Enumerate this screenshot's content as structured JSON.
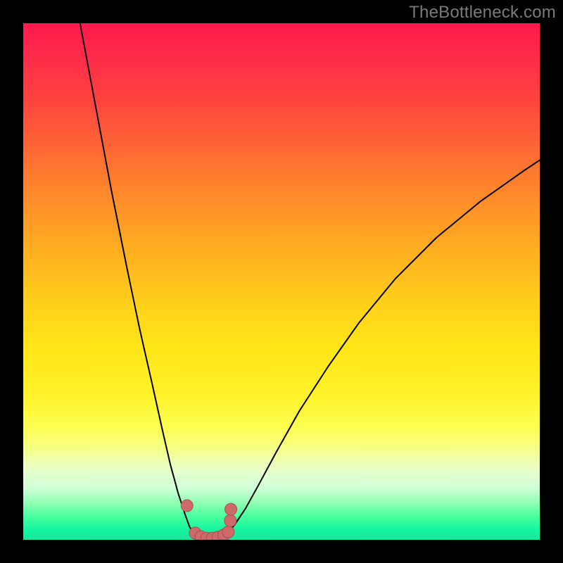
{
  "watermark": "TheBottleneck.com",
  "colors": {
    "background": "#000000",
    "watermark": "#7a7a7a",
    "curve": "#000000",
    "marker_fill": "#cf6a6a",
    "marker_stroke": "#a84f4f",
    "gradient_stops": [
      "#ff1a4d",
      "#ff2a4a",
      "#ff4040",
      "#ff6a33",
      "#ff8c2a",
      "#ffb21f",
      "#ffd21a",
      "#ffe617",
      "#fff22a",
      "#fdff4f",
      "#f7ff80",
      "#eaffc4",
      "#d0ffd9",
      "#8cffb0",
      "#3cff9e",
      "#17f5a0",
      "#13eaa0"
    ]
  },
  "chart_data": {
    "type": "line",
    "title": "",
    "xlabel": "",
    "ylabel": "",
    "xlim": [
      0,
      100
    ],
    "ylim": [
      0,
      100
    ],
    "grid": false,
    "legend": false,
    "note": "Axes have no visible tick labels; x/y are normalized percentages of the plot area (0 = left/bottom, 100 = right/top). Values estimated from pixel positions.",
    "series": [
      {
        "name": "left-branch",
        "x": [
          11.0,
          14.0,
          17.0,
          20.0,
          22.5,
          25.0,
          27.0,
          28.5,
          30.0,
          31.3,
          32.2,
          33.0
        ],
        "y": [
          100.0,
          84.0,
          68.0,
          53.0,
          41.0,
          30.0,
          21.0,
          14.5,
          9.0,
          5.0,
          2.5,
          1.2
        ]
      },
      {
        "name": "right-branch",
        "x": [
          39.5,
          41.0,
          43.0,
          45.5,
          49.0,
          53.5,
          59.0,
          65.0,
          72.0,
          80.0,
          88.5,
          97.0,
          100.0
        ],
        "y": [
          1.2,
          3.0,
          6.0,
          10.5,
          17.0,
          25.0,
          33.5,
          42.0,
          50.5,
          58.5,
          65.5,
          71.5,
          73.5
        ]
      },
      {
        "name": "valley-floor",
        "x": [
          33.0,
          34.2,
          35.4,
          36.6,
          37.8,
          39.0,
          39.5
        ],
        "y": [
          1.2,
          0.5,
          0.2,
          0.2,
          0.3,
          0.7,
          1.2
        ]
      }
    ],
    "markers": {
      "name": "salmon-dots",
      "note": "Small salmon-colored circular markers along the valley; one isolated marker slightly above the left rim.",
      "points": [
        {
          "x": 31.7,
          "y": 6.6
        },
        {
          "x": 33.3,
          "y": 1.3
        },
        {
          "x": 34.4,
          "y": 0.6
        },
        {
          "x": 35.5,
          "y": 0.3
        },
        {
          "x": 36.6,
          "y": 0.3
        },
        {
          "x": 37.7,
          "y": 0.5
        },
        {
          "x": 38.8,
          "y": 0.9
        },
        {
          "x": 39.7,
          "y": 1.5
        },
        {
          "x": 40.1,
          "y": 3.7
        },
        {
          "x": 40.2,
          "y": 5.9
        }
      ]
    }
  }
}
